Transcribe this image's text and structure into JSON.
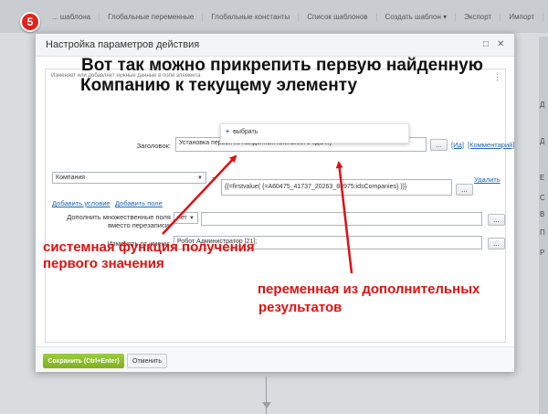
{
  "step_badge": "5",
  "background": {
    "tabs": [
      "Глобальные переменные",
      "Глобальные константы",
      "Список шаблонов",
      "Создать шаблон ▾",
      "Экспорт",
      "Импорт"
    ],
    "partial_tab": "... шаблона",
    "right_panel_items": [
      "Д",
      "Д",
      "Е",
      "С",
      "В",
      "П",
      "Р"
    ]
  },
  "dialog": {
    "title": "Настройка параметров действия",
    "minimize_icon": "square-icon",
    "close_icon": "x-icon",
    "description": "Изменяет или добавляет нужные данные в поле элемента",
    "menu_dots": "⋮",
    "fields": {
      "title_label": "Заголовок:",
      "title_value": "Установка первой из найденных компаний в сделку",
      "title_btn": "...",
      "title_link_id": "[Ид]",
      "title_link_comment": "[Комментарий]",
      "field_select": "Компания",
      "equals": "=",
      "popup_plus": "+",
      "popup_choose": "выбрать",
      "expression": "{{=firstvalue( {=A60475_41737_20263_83975:idsCompanies} )}}",
      "expr_btn": "...",
      "delete_link": "Удалить",
      "add_condition": "Добавить условие",
      "add_field": "Добавить поле",
      "multi_label_1": "Дополнить множественные поля",
      "multi_label_2": "вместо перезаписи:",
      "multi_value": "нет",
      "multi_btn": "...",
      "author_label": "Изменять от имени:",
      "author_value": "Робот Администратор [21];",
      "author_btn": "..."
    },
    "footer": {
      "save": "Сохранить (Ctrl+Enter)",
      "cancel": "Отменить"
    }
  },
  "annotations": {
    "headline_1": "Вот так можно прикрепить первую найденную",
    "headline_2": "Компанию к текущему элементу",
    "func_1": "системная функция получения",
    "func_2": "первого значения",
    "var_1": "переменная из дополнительных",
    "var_2": "результатов",
    "arrow_color": "#e01010"
  }
}
